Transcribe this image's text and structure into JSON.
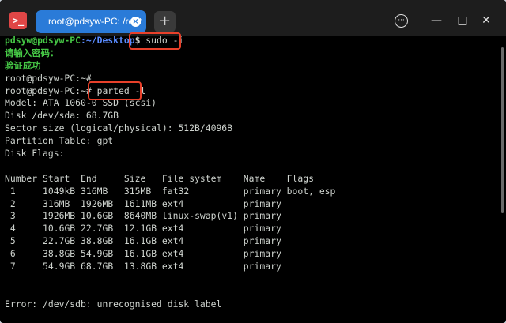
{
  "titlebar": {
    "tab_title": "root@pdsyw-PC: /root",
    "add_tab": "+",
    "menu": "···",
    "minimize": "—",
    "maximize": "□",
    "close": "✕"
  },
  "terminal": {
    "prompt1_user": "pdsyw@pdsyw-PC",
    "prompt1_path": ":~/Desktop",
    "prompt1_dollar": "$",
    "command1": " sudo -i",
    "password_prompt": "请输入密码：",
    "auth_success": "验证成功",
    "root_prompt1": "root@pdsyw-PC:~#",
    "root_prompt2": "root@pdsyw-PC:~#",
    "command2": " parted -l",
    "model": "Model: ATA 1060-0 SSD (scsi)",
    "disk": "Disk /dev/sda: 68.7GB",
    "sector": "Sector size (logical/physical): 512B/4096B",
    "table": "Partition Table: gpt",
    "flags": "Disk Flags:",
    "headers": [
      "Number",
      "Start",
      "End",
      "Size",
      "File system",
      "Name",
      "Flags"
    ],
    "partitions": [
      {
        "num": " 1",
        "start": "1049kB",
        "end": "316MB",
        "size": "315MB",
        "fs": "fat32",
        "name": "primary",
        "flags": "boot, esp"
      },
      {
        "num": " 2",
        "start": "316MB",
        "end": "1926MB",
        "size": "1611MB",
        "fs": "ext4",
        "name": "primary",
        "flags": ""
      },
      {
        "num": " 3",
        "start": "1926MB",
        "end": "10.6GB",
        "size": "8640MB",
        "fs": "linux-swap(v1)",
        "name": "primary",
        "flags": ""
      },
      {
        "num": " 4",
        "start": "10.6GB",
        "end": "22.7GB",
        "size": "12.1GB",
        "fs": "ext4",
        "name": "primary",
        "flags": ""
      },
      {
        "num": " 5",
        "start": "22.7GB",
        "end": "38.8GB",
        "size": "16.1GB",
        "fs": "ext4",
        "name": "primary",
        "flags": ""
      },
      {
        "num": " 6",
        "start": "38.8GB",
        "end": "54.9GB",
        "size": "16.1GB",
        "fs": "ext4",
        "name": "primary",
        "flags": ""
      },
      {
        "num": " 7",
        "start": "54.9GB",
        "end": "68.7GB",
        "size": "13.8GB",
        "fs": "ext4",
        "name": "primary",
        "flags": ""
      }
    ],
    "error": "Error: /dev/sdb: unrecognised disk label"
  },
  "colors": {
    "prompt_green": "#46c846",
    "path_blue": "#5a8cff",
    "highlight_red": "#e8402a",
    "tab_blue": "#2a7bd8"
  }
}
